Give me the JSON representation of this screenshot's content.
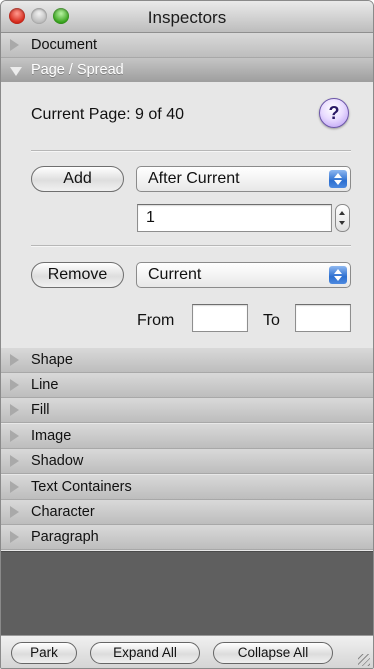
{
  "window": {
    "title": "Inspectors"
  },
  "sections": {
    "document": "Document",
    "page_spread": "Page / Spread",
    "shape": "Shape",
    "line": "Line",
    "fill": "Fill",
    "image": "Image",
    "shadow": "Shadow",
    "text_containers": "Text Containers",
    "character": "Character",
    "paragraph": "Paragraph"
  },
  "page_panel": {
    "current_page": "Current Page: 9 of 40",
    "help_label": "?",
    "add_label": "Add",
    "add_position": "After Current",
    "add_count": "1",
    "remove_label": "Remove",
    "remove_scope": "Current",
    "from_label": "From",
    "from_value": "",
    "to_label": "To",
    "to_value": ""
  },
  "footer": {
    "park": "Park",
    "expand_all": "Expand All",
    "collapse_all": "Collapse All"
  },
  "colors": {
    "help_accent": "#b394f2",
    "popup_arrows": "#2c6fd0",
    "close_light": "#d62a1c",
    "zoom_light": "#3aa51f"
  }
}
